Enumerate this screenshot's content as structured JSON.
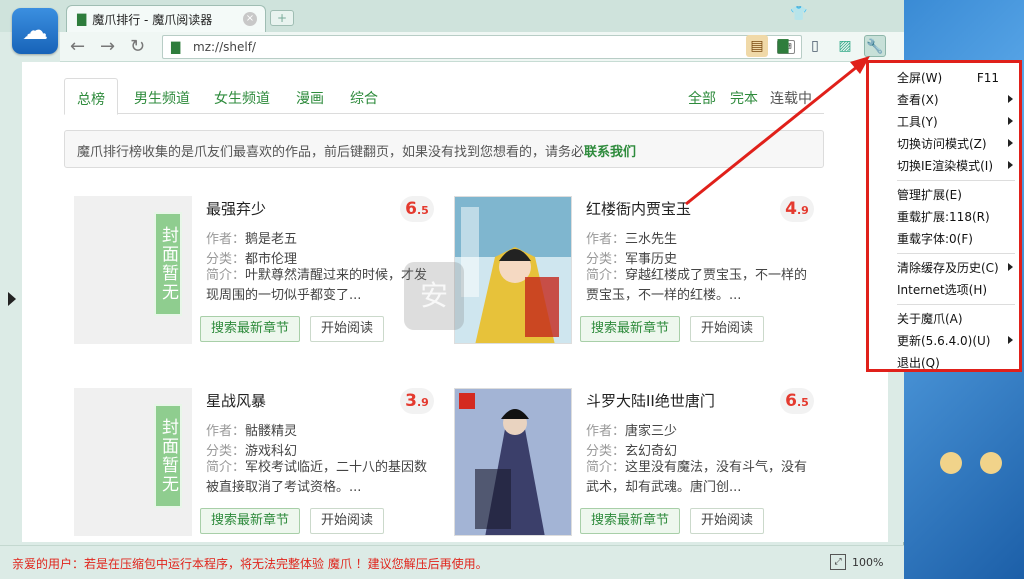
{
  "window": {
    "tab_title": "魔爪排行 - 魔爪阅读器",
    "new_tab_symbol": "+",
    "close_symbol": "×",
    "url": "mz://shelf/"
  },
  "pagetabs": [
    "总榜",
    "男生频道",
    "女生频道",
    "漫画",
    "综合"
  ],
  "filters": [
    "全部",
    "完本",
    "连载中"
  ],
  "notice": {
    "text": "魔爪排行榜收集的是爪友们最喜欢的作品，前后键翻页，如果没有找到您想看的，请务必",
    "link": "联系我们"
  },
  "labels": {
    "author": "作者：",
    "category": "分类：",
    "intro": "简介："
  },
  "books": [
    {
      "title": "最强弃少",
      "score_int": "6",
      "score_dec": ".5",
      "author": "鹅是老五",
      "category": "都市伦理",
      "intro": "叶默尊然清醒过来的时候，才发现周围的一切似乎都变了...",
      "placeholder": "封面暂无",
      "cover": "none",
      "search_btn": "搜索最新章节",
      "read_btn": "开始阅读"
    },
    {
      "title": "红楼衙内贾宝玉",
      "score_int": "4",
      "score_dec": ".9",
      "author": "三水先生",
      "category": "军事历史",
      "intro": "穿越红楼成了贾宝玉，不一样的贾宝玉，不一样的红楼。...",
      "placeholder": "",
      "cover": "image",
      "search_btn": "搜索最新章节",
      "read_btn": "开始阅读"
    },
    {
      "title": "星战风暴",
      "score_int": "3",
      "score_dec": ".9",
      "author": "骷髅精灵",
      "category": "游戏科幻",
      "intro": "军校考试临近，二十八的基因数被直接取消了考试资格。...",
      "placeholder": "封面暂无",
      "cover": "none",
      "search_btn": "搜索最新章节",
      "read_btn": "开始阅读"
    },
    {
      "title": "斗罗大陆II绝世唐门",
      "score_int": "6",
      "score_dec": ".5",
      "author": "唐家三少",
      "category": "玄幻奇幻",
      "intro": "这里没有魔法，没有斗气，没有武术，却有武魂。唐门创...",
      "placeholder": "",
      "cover": "image",
      "search_btn": "搜索最新章节",
      "read_btn": "开始阅读"
    }
  ],
  "menu": [
    {
      "label": "全屏(W)",
      "shortcut": "F11",
      "sub": false
    },
    {
      "label": "查看(X)",
      "shortcut": "",
      "sub": true
    },
    {
      "label": "工具(Y)",
      "shortcut": "",
      "sub": true
    },
    {
      "label": "切换访问模式(Z)",
      "shortcut": "",
      "sub": true
    },
    {
      "label": "切换IE渲染模式(I)",
      "shortcut": "",
      "sub": true
    },
    {
      "sep": true
    },
    {
      "label": "管理扩展(E)",
      "shortcut": "",
      "sub": false
    },
    {
      "label": "重载扩展:118(R)",
      "shortcut": "",
      "sub": false
    },
    {
      "label": "重载字体:0(F)",
      "shortcut": "",
      "sub": false
    },
    {
      "sep": true
    },
    {
      "label": "清除缓存及历史(C)",
      "shortcut": "",
      "sub": true
    },
    {
      "label": "Internet选项(H)",
      "shortcut": "",
      "sub": false
    },
    {
      "sep": true
    },
    {
      "label": "关于魔爪(A)",
      "shortcut": "",
      "sub": false
    },
    {
      "label": "更新(5.6.4.0)(U)",
      "shortcut": "",
      "sub": true
    },
    {
      "label": "退出(Q)",
      "shortcut": "",
      "sub": false
    }
  ],
  "status": {
    "message": "亲爱的用户：若是在压缩包中运行本程序，将无法完整体验 魔爪 ！建议您解压后再使用。",
    "zoom": "100%"
  },
  "colors": {
    "accent": "#2e8b3c",
    "score": "#e43a2f",
    "highlight": "#e0201a"
  }
}
